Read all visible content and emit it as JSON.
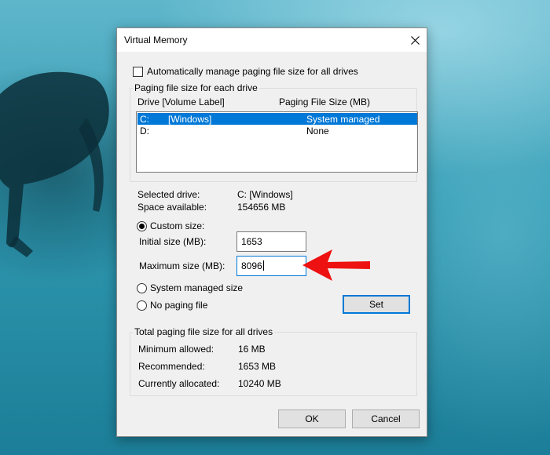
{
  "window": {
    "title": "Virtual Memory"
  },
  "auto_manage": {
    "label": "Automatically manage paging file size for all drives",
    "checked": false
  },
  "drives_group": {
    "title": "Paging file size for each drive",
    "col_drive": "Drive  [Volume Label]",
    "col_size": "Paging File Size (MB)",
    "rows": [
      {
        "drive": "C:",
        "label": "[Windows]",
        "size": "System managed",
        "selected": true
      },
      {
        "drive": "D:",
        "label": "",
        "size": "None",
        "selected": false
      }
    ]
  },
  "selected_drive": {
    "label": "Selected drive:",
    "value": "C:  [Windows]"
  },
  "space_available": {
    "label": "Space available:",
    "value": "154656 MB"
  },
  "custom_size": {
    "label": "Custom size:",
    "checked": true
  },
  "initial_size": {
    "label": "Initial size (MB):",
    "value": "1653"
  },
  "maximum_size": {
    "label": "Maximum size (MB):",
    "value": "8096"
  },
  "system_managed": {
    "label": "System managed size",
    "checked": false
  },
  "no_paging": {
    "label": "No paging file",
    "checked": false
  },
  "set_button": {
    "label": "Set"
  },
  "totals_group": {
    "title": "Total paging file size for all drives",
    "min_label": "Minimum allowed:",
    "min_value": "16 MB",
    "rec_label": "Recommended:",
    "rec_value": "1653 MB",
    "cur_label": "Currently allocated:",
    "cur_value": "10240 MB"
  },
  "ok_button": {
    "label": "OK"
  },
  "cancel_button": {
    "label": "Cancel"
  },
  "colors": {
    "accent": "#0078d7",
    "annotation_arrow": "#ee1111"
  }
}
